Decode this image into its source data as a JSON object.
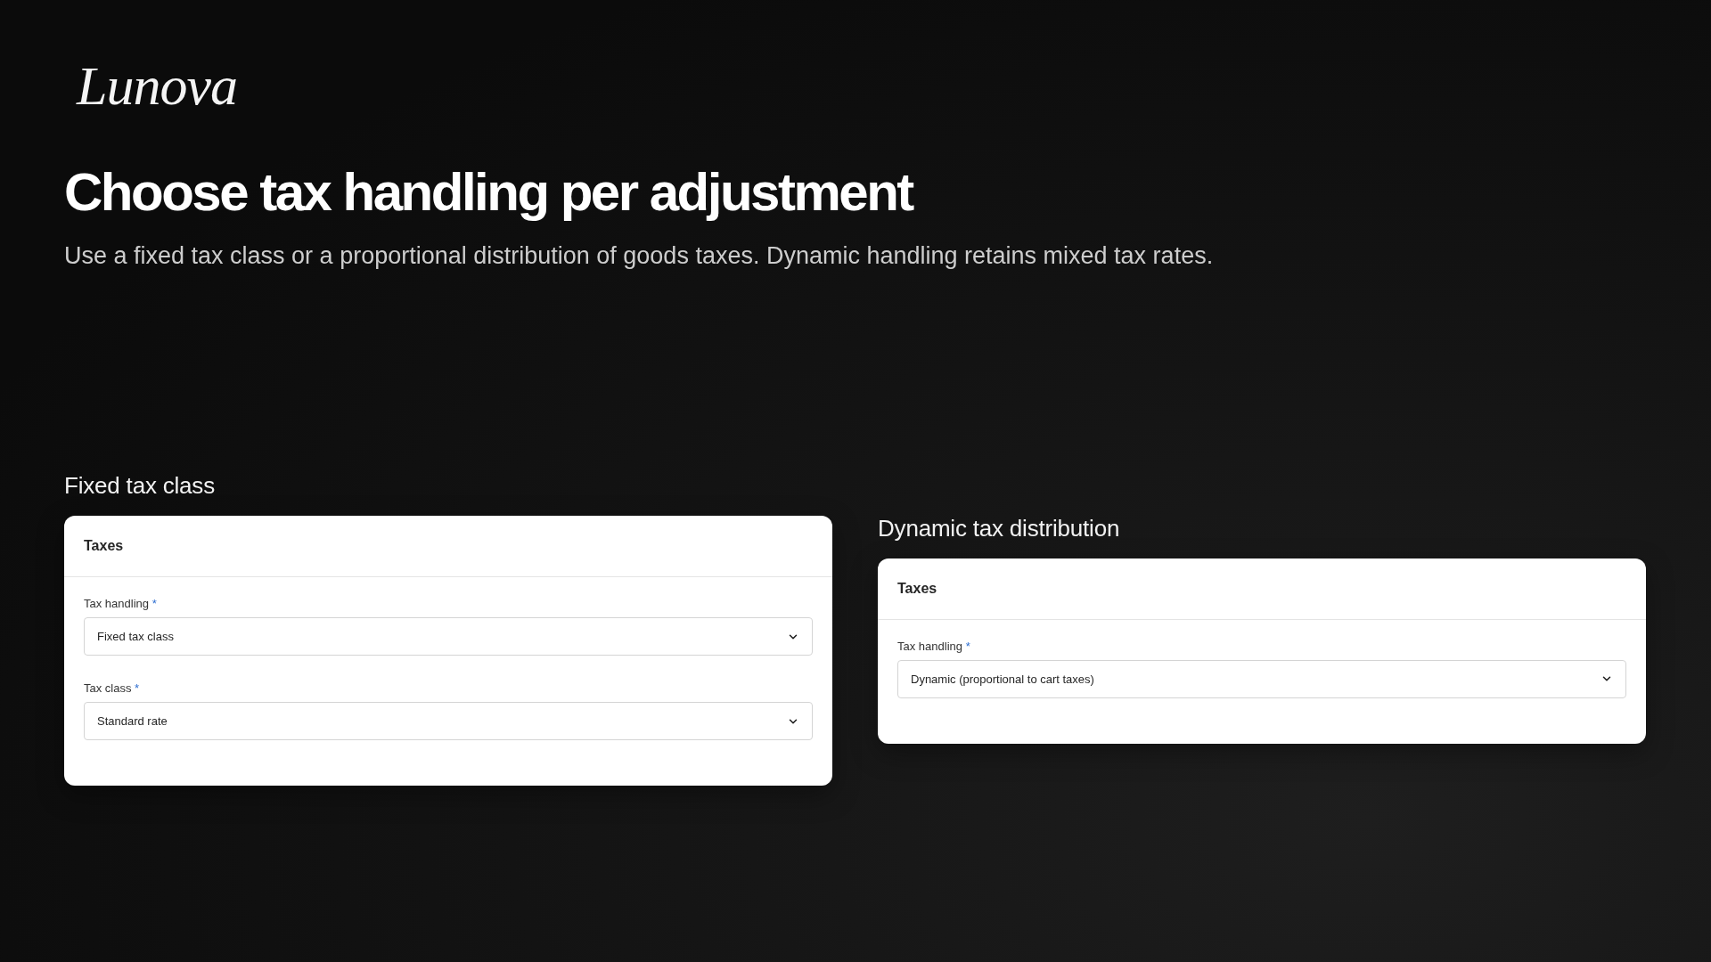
{
  "logo": {
    "text": "Lunova"
  },
  "heading": "Choose tax handling per adjustment",
  "subtitle": "Use a fixed tax class or a proportional distribution of goods taxes. Dynamic handling retains mixed tax rates.",
  "panels": [
    {
      "title": "Fixed tax class",
      "card": {
        "title": "Taxes",
        "fields": [
          {
            "label": "Tax handling",
            "required_mark": "*",
            "value": "Fixed tax class"
          },
          {
            "label": "Tax class",
            "required_mark": "*",
            "value": "Standard rate"
          }
        ]
      }
    },
    {
      "title": "Dynamic tax distribution",
      "card": {
        "title": "Taxes",
        "fields": [
          {
            "label": "Tax handling",
            "required_mark": "*",
            "value": "Dynamic (proportional to cart taxes)"
          }
        ]
      }
    }
  ]
}
